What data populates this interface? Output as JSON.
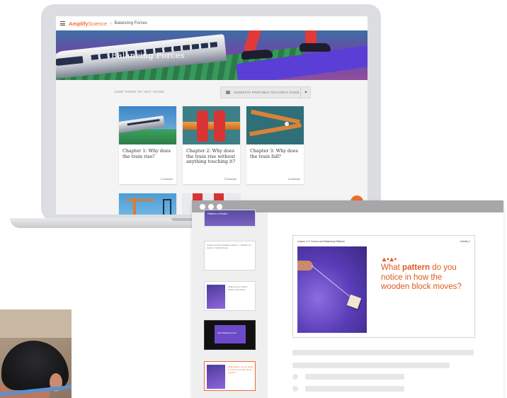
{
  "laptop": {
    "brand_part1": "Amplify",
    "brand_part2": "Science",
    "breadcrumb": "Balancing Forces",
    "unit_title": "Balancing Forces",
    "jump_label": "JUMP DOWN TO UNIT GUIDE",
    "guide_button_label": "GENERATE PRINTABLE TEACHER'S GUIDE",
    "chapters": [
      {
        "title": "Chapter 1: Why does the train rise?",
        "lessons": "4 Lessons"
      },
      {
        "title": "Chapter 2: Why does the train rise without anything touching it?",
        "lessons": "3 Lessons"
      },
      {
        "title": "Chapter 3: Why does the train fall?",
        "lessons": "4 Lessons"
      }
    ],
    "accent_color": "#f06d2f"
  },
  "presentation": {
    "thumbnails": [
      {
        "text": "Patterns of Motion"
      },
      {
        "text": "Today we will investigate patterns. • Explain our claims • Identify forces"
      },
      {
        "text": "What do you notice? Observe the block."
      },
      {
        "text": "Video: Balancing Forces"
      },
      {
        "text": "What pattern do you notice in how the wooden block moves?"
      }
    ],
    "slide": {
      "header": "Lesson 1.2: Forces and Balancing Patterns",
      "header_right": "Activity 1",
      "icons": "▴▪▴▪",
      "question_pre": "What ",
      "question_bold": "pattern",
      "question_post": " do you notice in how the wooden block moves?"
    }
  }
}
